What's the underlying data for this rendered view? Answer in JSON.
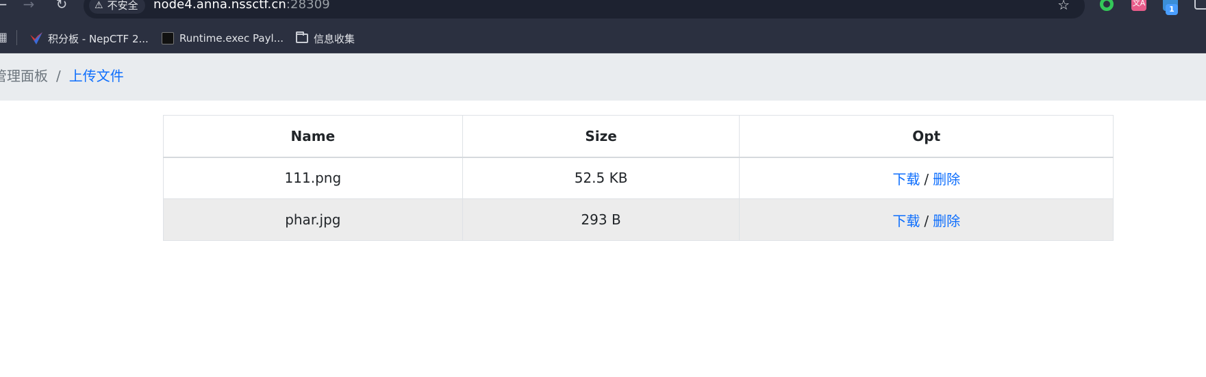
{
  "browser": {
    "security_label": "不安全",
    "url_host": "node4.anna.nssctf.cn",
    "url_port": ":28309",
    "extension_badge": "1"
  },
  "bookmarks": [
    {
      "label": "积分板 - NepCTF 2...",
      "icon": "nepctf-icon"
    },
    {
      "label": "Runtime.exec Payl...",
      "icon": "runtime-icon"
    },
    {
      "label": "信息收集",
      "icon": "folder-icon"
    }
  ],
  "breadcrumb": {
    "parent": "管理面板",
    "separator": "/",
    "current": "上传文件"
  },
  "table": {
    "headers": {
      "name": "Name",
      "size": "Size",
      "opt": "Opt"
    },
    "rows": [
      {
        "name": "111.png",
        "size": "52.5 KB",
        "download": "下载",
        "sep": "/",
        "delete": "删除"
      },
      {
        "name": "phar.jpg",
        "size": "293 B",
        "download": "下载",
        "sep": "/",
        "delete": "删除"
      }
    ]
  },
  "colors": {
    "link": "#0d6efd",
    "chrome_bg": "#2b3040",
    "breadcrumb_bg": "#e9ecef"
  }
}
